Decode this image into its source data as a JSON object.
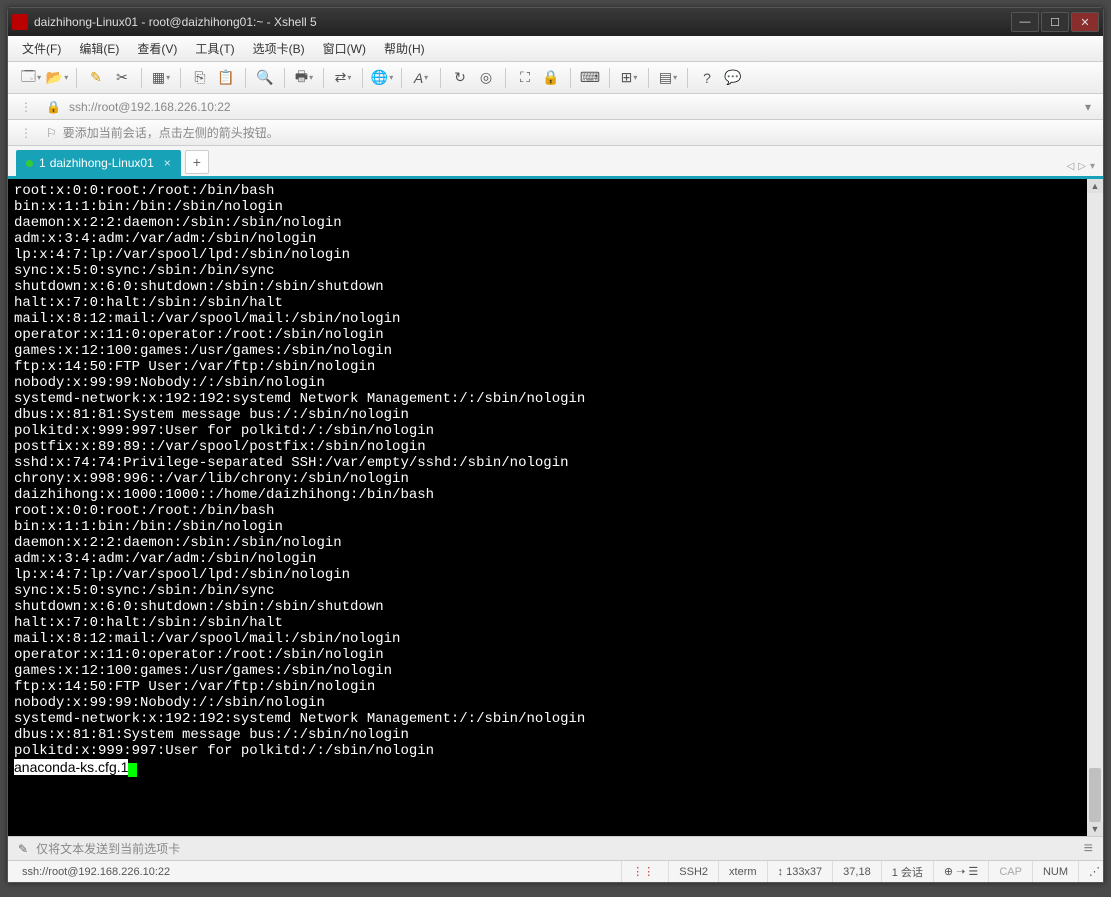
{
  "titlebar": {
    "title": "daizhihong-Linux01 - root@daizhihong01:~ - Xshell 5"
  },
  "menu": {
    "file": "文件(F)",
    "edit": "编辑(E)",
    "view": "查看(V)",
    "tools": "工具(T)",
    "tabs": "选项卡(B)",
    "window": "窗口(W)",
    "help": "帮助(H)"
  },
  "addr": {
    "text": "ssh://root@192.168.226.10:22"
  },
  "info": {
    "text": "要添加当前会话，点击左侧的箭头按钮。"
  },
  "tab": {
    "num": "1",
    "name": "daizhihong-Linux01",
    "plus": "+"
  },
  "terminal_lines": [
    "root:x:0:0:root:/root:/bin/bash",
    "bin:x:1:1:bin:/bin:/sbin/nologin",
    "daemon:x:2:2:daemon:/sbin:/sbin/nologin",
    "adm:x:3:4:adm:/var/adm:/sbin/nologin",
    "lp:x:4:7:lp:/var/spool/lpd:/sbin/nologin",
    "sync:x:5:0:sync:/sbin:/bin/sync",
    "shutdown:x:6:0:shutdown:/sbin:/sbin/shutdown",
    "halt:x:7:0:halt:/sbin:/sbin/halt",
    "mail:x:8:12:mail:/var/spool/mail:/sbin/nologin",
    "operator:x:11:0:operator:/root:/sbin/nologin",
    "games:x:12:100:games:/usr/games:/sbin/nologin",
    "ftp:x:14:50:FTP User:/var/ftp:/sbin/nologin",
    "nobody:x:99:99:Nobody:/:/sbin/nologin",
    "systemd-network:x:192:192:systemd Network Management:/:/sbin/nologin",
    "dbus:x:81:81:System message bus:/:/sbin/nologin",
    "polkitd:x:999:997:User for polkitd:/:/sbin/nologin",
    "postfix:x:89:89::/var/spool/postfix:/sbin/nologin",
    "sshd:x:74:74:Privilege-separated SSH:/var/empty/sshd:/sbin/nologin",
    "chrony:x:998:996::/var/lib/chrony:/sbin/nologin",
    "daizhihong:x:1000:1000::/home/daizhihong:/bin/bash",
    "root:x:0:0:root:/root:/bin/bash",
    "bin:x:1:1:bin:/bin:/sbin/nologin",
    "daemon:x:2:2:daemon:/sbin:/sbin/nologin",
    "adm:x:3:4:adm:/var/adm:/sbin/nologin",
    "lp:x:4:7:lp:/var/spool/lpd:/sbin/nologin",
    "sync:x:5:0:sync:/sbin:/bin/sync",
    "shutdown:x:6:0:shutdown:/sbin:/sbin/shutdown",
    "halt:x:7:0:halt:/sbin:/sbin/halt",
    "mail:x:8:12:mail:/var/spool/mail:/sbin/nologin",
    "operator:x:11:0:operator:/root:/sbin/nologin",
    "games:x:12:100:games:/usr/games:/sbin/nologin",
    "ftp:x:14:50:FTP User:/var/ftp:/sbin/nologin",
    "nobody:x:99:99:Nobody:/:/sbin/nologin",
    "systemd-network:x:192:192:systemd Network Management:/:/sbin/nologin",
    "dbus:x:81:81:System message bus:/:/sbin/nologin",
    "polkitd:x:999:997:User for polkitd:/:/sbin/nologin"
  ],
  "terminal_last": "anaconda-ks.cfg.1",
  "sendbar": {
    "text": "仅将文本发送到当前选项卡"
  },
  "status": {
    "left": "ssh://root@192.168.226.10:22",
    "ssh": "SSH2",
    "term": "xterm",
    "size": "133x37",
    "pos": "37,18",
    "sess": "1 会话",
    "cap": "CAP",
    "num": "NUM",
    "dots": "⋮⋮",
    "arrows": "↕"
  }
}
